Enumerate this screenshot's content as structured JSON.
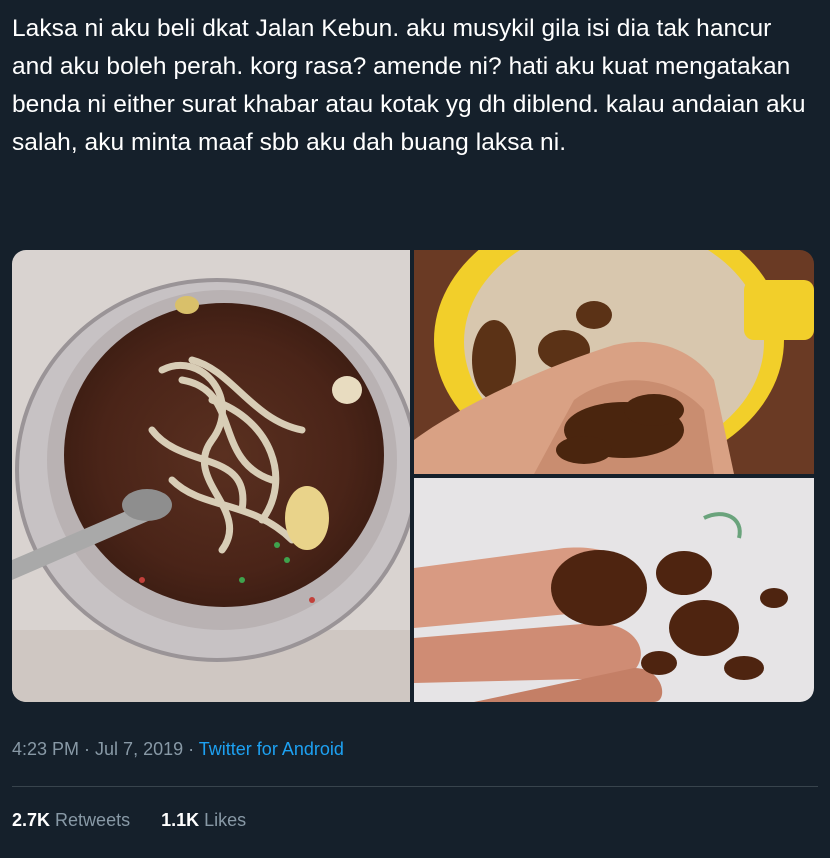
{
  "tweet": {
    "text": "Laksa ni aku beli dkat Jalan Kebun. aku musykil gila isi dia tak hancur and aku boleh perah. korg rasa? amende ni? hati aku kuat mengatakan benda ni either surat khabar atau kotak yg dh diblend. kalau andaian aku salah, aku minta maaf sbb aku dah buang laksa ni."
  },
  "meta": {
    "time": "4:23 PM",
    "separator": " · ",
    "date": "Jul 7, 2019",
    "source": "Twitter for Android"
  },
  "stats": {
    "retweets_count": "2.7K",
    "retweets_label": "Retweets",
    "likes_count": "1.1K",
    "likes_label": "Likes"
  },
  "colors": {
    "background": "#15202b",
    "text": "#ffffff",
    "muted": "#8899a6",
    "link": "#1da1f2",
    "divider": "#38444d"
  }
}
